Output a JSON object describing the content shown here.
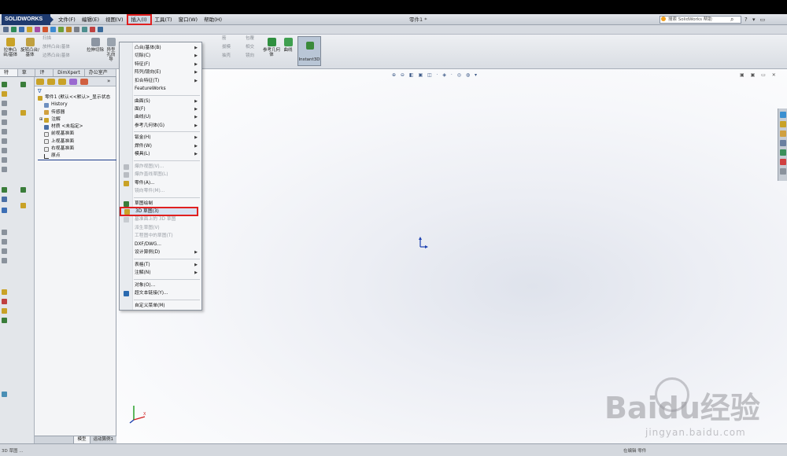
{
  "app": {
    "logo_text": "SOLIDWORKS",
    "doc_title": "零件1 *",
    "menus": [
      "文件(F)",
      "编辑(E)",
      "视图(V)",
      "插入(I)",
      "工具(T)",
      "窗口(W)",
      "帮助(H)"
    ],
    "active_menu": "插入(I)",
    "help_search_placeholder": "搜索 SolidWorks 帮助"
  },
  "command_manager": {
    "left_buttons": [
      "拉伸凸台/基体",
      "旋转凸台/基体"
    ],
    "small_items": [
      "扫描",
      "放样凸台/基体",
      "边界凸台/基体"
    ],
    "cut_buttons": [
      "拉伸切除",
      "异型孔向导"
    ],
    "right_items": [
      "筋",
      "拔模",
      "抽壳",
      "包覆",
      "相交",
      "镜向"
    ],
    "ref_geometry": "参考几何体",
    "curves": "曲线",
    "instant3d": "Instant3D"
  },
  "tabs": [
    "特征",
    "草图",
    "评估",
    "DimXpert",
    "办公室产品"
  ],
  "tree": {
    "items": [
      "零件1 (默认<<默认>_显示状态",
      "History",
      "传感器",
      "注解",
      "材质 <未指定>",
      "前视基准面",
      "上视基准面",
      "右视基准面",
      "原点"
    ],
    "bottom_tabs": [
      "模型",
      "运动算例1"
    ]
  },
  "insert_menu": [
    {
      "label": "凸台/基体(B)",
      "submenu": true,
      "disabled": false,
      "icon": ""
    },
    {
      "label": "切除(C)",
      "submenu": true,
      "disabled": false,
      "icon": ""
    },
    {
      "label": "特征(F)",
      "submenu": true,
      "disabled": false,
      "icon": ""
    },
    {
      "label": "阵列/镜向(E)",
      "submenu": true,
      "disabled": false,
      "icon": ""
    },
    {
      "label": "扣合特征(T)",
      "submenu": true,
      "disabled": false,
      "icon": ""
    },
    {
      "label": "FeatureWorks",
      "submenu": false,
      "disabled": false,
      "icon": ""
    },
    {
      "sep": true
    },
    {
      "label": "曲面(S)",
      "submenu": true,
      "disabled": false,
      "icon": ""
    },
    {
      "label": "面(F)",
      "submenu": true,
      "disabled": false,
      "icon": ""
    },
    {
      "label": "曲线(U)",
      "submenu": true,
      "disabled": false,
      "icon": ""
    },
    {
      "label": "参考几何体(G)",
      "submenu": true,
      "disabled": false,
      "icon": ""
    },
    {
      "sep": true
    },
    {
      "label": "钣金(H)",
      "submenu": true,
      "disabled": false,
      "icon": ""
    },
    {
      "label": "焊件(W)",
      "submenu": true,
      "disabled": false,
      "icon": ""
    },
    {
      "label": "模具(L)",
      "submenu": true,
      "disabled": false,
      "icon": ""
    },
    {
      "sep": true
    },
    {
      "label": "爆炸视图(V)...",
      "submenu": false,
      "disabled": true,
      "icon": "explode-icon"
    },
    {
      "label": "爆炸直线草图(L)",
      "submenu": false,
      "disabled": true,
      "icon": "explode-line-icon"
    },
    {
      "label": "零件(A)...",
      "submenu": false,
      "disabled": false,
      "icon": "part-icon"
    },
    {
      "label": "镜向零件(M)...",
      "submenu": false,
      "disabled": true,
      "icon": ""
    },
    {
      "sep": true
    },
    {
      "label": "草图绘制",
      "submenu": false,
      "disabled": false,
      "icon": "sketch-icon"
    },
    {
      "label": "3D 草图(3)",
      "submenu": false,
      "disabled": false,
      "icon": "sketch3d-icon",
      "highlight": true
    },
    {
      "label": "基准面上的 3D 草图",
      "submenu": false,
      "disabled": true,
      "icon": "sketch3d-plane-icon"
    },
    {
      "label": "派生草图(V)",
      "submenu": false,
      "disabled": true,
      "icon": ""
    },
    {
      "label": "工程图中的草图(T)",
      "submenu": false,
      "disabled": true,
      "icon": ""
    },
    {
      "label": "DXF/DWG...",
      "submenu": false,
      "disabled": false,
      "icon": ""
    },
    {
      "label": "设计算例(D)",
      "submenu": true,
      "disabled": false,
      "icon": ""
    },
    {
      "sep": true
    },
    {
      "label": "表格(T)",
      "submenu": true,
      "disabled": false,
      "icon": ""
    },
    {
      "label": "注解(N)",
      "submenu": true,
      "disabled": false,
      "icon": ""
    },
    {
      "sep": true
    },
    {
      "label": "对象(O)...",
      "submenu": false,
      "disabled": false,
      "icon": ""
    },
    {
      "label": "超文本链接(Y)...",
      "submenu": false,
      "disabled": false,
      "icon": "hyperlink-icon"
    },
    {
      "sep": true
    },
    {
      "label": "自定义菜单(M)",
      "submenu": false,
      "disabled": false,
      "icon": ""
    }
  ],
  "status": {
    "left": "3D 草图 ...",
    "right": "在编辑 零件"
  },
  "watermark": {
    "brand": "Baidu经验",
    "url": "jingyan.baidu.com"
  },
  "colors": {
    "highlight_red": "#e02020",
    "logo_blue": "#1e3a6e"
  }
}
